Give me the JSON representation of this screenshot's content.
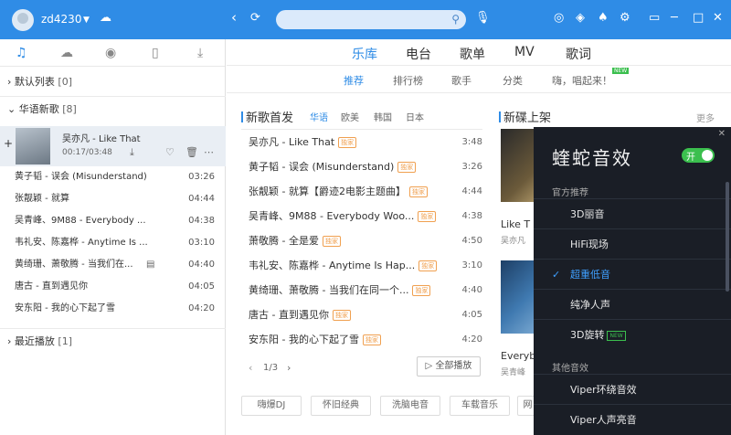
{
  "topbar": {
    "username": "zd4230"
  },
  "left": {
    "sections": [
      {
        "label": "默认列表",
        "count": "[0]"
      },
      {
        "label": "华语新歌",
        "count": "[8]"
      },
      {
        "label": "最近播放",
        "count": "[1]"
      }
    ],
    "current": {
      "title": "吴亦凡 - Like That",
      "time": "00:17/03:48"
    },
    "songs": [
      {
        "t": "黄子韬 - 误会 (Misunderstand)",
        "d": "03:26"
      },
      {
        "t": "张靓颖 - 就算",
        "d": "04:44"
      },
      {
        "t": "吴青峰、9M88 - Everybody ...",
        "d": "04:38"
      },
      {
        "t": "韦礼安、陈嘉桦 - Anytime Is ...",
        "d": "03:10"
      },
      {
        "t": "黄绮珊、萧敬腾 - 当我们在...",
        "d": "04:40"
      },
      {
        "t": "唐古 - 直到遇见你",
        "d": "04:05"
      },
      {
        "t": "安东阳 - 我的心下起了雪",
        "d": "04:20"
      }
    ]
  },
  "main": {
    "tabs": [
      "乐库",
      "电台",
      "歌单",
      "MV",
      "歌词"
    ],
    "subtabs": [
      "推荐",
      "排行榜",
      "歌手",
      "分类",
      "嗨，唱起来！"
    ],
    "new_badge": "NEW",
    "newsongs_title": "新歌首发",
    "filters": [
      "华语",
      "欧美",
      "韩国",
      "日本"
    ],
    "newsongs": [
      {
        "t": "吴亦凡 - Like That",
        "b": "独家",
        "d": "3:48"
      },
      {
        "t": "黄子韬 - 误会 (Misunderstand)",
        "b": "独家",
        "d": "3:26"
      },
      {
        "t": "张靓颖 - 就算【爵迹2电影主题曲】",
        "b": "独家",
        "d": "4:44"
      },
      {
        "t": "吴青峰、9M88 - Everybody Woo...",
        "b": "独家",
        "d": "4:38"
      },
      {
        "t": "萧敬腾 - 全是爱",
        "b": "独家",
        "d": "4:50"
      },
      {
        "t": "韦礼安、陈嘉桦 - Anytime Is Hap...",
        "b": "独家",
        "d": "3:10"
      },
      {
        "t": "黄绮珊、萧敬腾 - 当我们在同一个...",
        "b": "独家",
        "d": "4:40"
      },
      {
        "t": "唐古 - 直到遇见你",
        "b": "独家",
        "d": "4:05"
      },
      {
        "t": "安东阳 - 我的心下起了雪",
        "b": "独家",
        "d": "4:20"
      }
    ],
    "pager": "1/3",
    "play_all": "全部播放",
    "albums_title": "新碟上架",
    "more": "更多",
    "album1_title": "Like T",
    "album1_artist": "吴亦凡",
    "album2_title": "Everyb",
    "album2_artist": "吴青峰",
    "tags": [
      "嗨爆DJ",
      "怀旧经典",
      "洗脑电音",
      "车载音乐",
      "网"
    ]
  },
  "fx": {
    "title": "蝰蛇音效",
    "toggle": "开",
    "sec1": "官方推荐",
    "sec2": "其他音效",
    "items1": [
      "3D丽音",
      "HiFi现场",
      "超重低音",
      "纯净人声",
      "3D旋转"
    ],
    "items2": [
      "Viper环绕音效",
      "Viper人声亮音"
    ],
    "new_badge": "NEW"
  }
}
